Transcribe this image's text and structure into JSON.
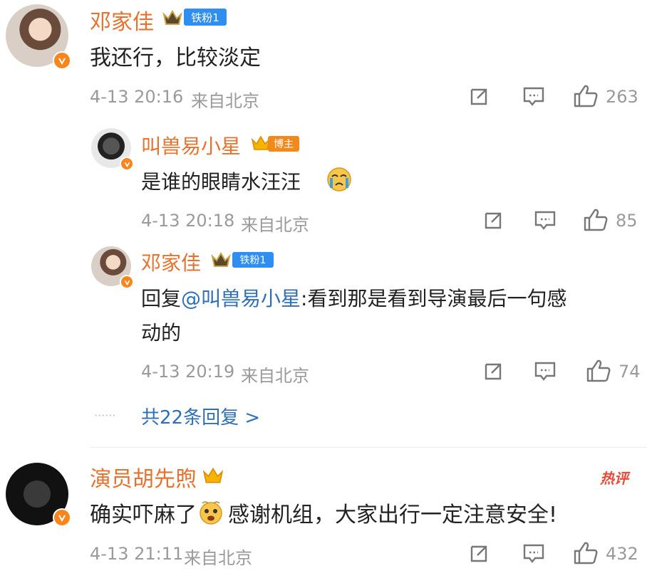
{
  "comments": [
    {
      "author": "邓家佳",
      "badge": "铁粉1",
      "text": "我还行，比较淡定",
      "time": "4-13 20:16",
      "location": "来自北京",
      "likes": "263"
    },
    {
      "author": "叫兽易小星",
      "badge": "博主",
      "text": "是谁的眼睛水汪汪",
      "time": "4-13 20:18",
      "location": "来自北京",
      "likes": "85"
    },
    {
      "author": "邓家佳",
      "badge": "铁粉1",
      "reply_prefix": "回复",
      "mention": "@叫兽易小星",
      "text_line1": ":看到那是看到导演最后一句感",
      "text_line2": "动的",
      "time": "4-13 20:19",
      "location": "来自北京",
      "likes": "74"
    },
    {
      "author": "演员胡先煦",
      "hot_tag": "热评",
      "text_part1": "确实吓麻了",
      "text_part2": "感谢机组，大家出行一定注意安全!",
      "time": "4-13 21:11",
      "location": "来自北京",
      "likes": "432"
    }
  ],
  "more_replies": {
    "dots": "······",
    "label": "共22条回复 >"
  },
  "icons": {
    "share": "share-icon",
    "comment": "comment-icon",
    "like": "thumbs-up-icon",
    "verified": "verified-v-icon",
    "crown": "crown-icon"
  },
  "colors": {
    "name": "#e8722d",
    "link": "#2f6fb8",
    "meta": "#9a9a9a",
    "badge_blue": "#2e8ff0",
    "verified": "#f7861c",
    "hot": "#e84a3a"
  }
}
